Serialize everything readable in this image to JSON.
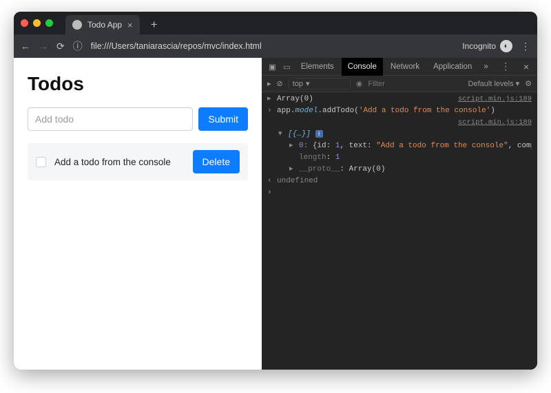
{
  "browser": {
    "tab_title": "Todo App",
    "url": "file:///Users/taniarascia/repos/mvc/index.html",
    "incognito_label": "Incognito"
  },
  "app": {
    "heading": "Todos",
    "input_placeholder": "Add todo",
    "submit_label": "Submit",
    "todo_text": "Add a todo from the console",
    "delete_label": "Delete"
  },
  "devtools": {
    "tabs": {
      "elements": "Elements",
      "console": "Console",
      "network": "Network",
      "application": "Application"
    },
    "toolbar": {
      "context": "top",
      "filter_placeholder": "Filter",
      "levels": "Default levels"
    },
    "console": {
      "line1": "Array(0)",
      "src1": "script.min.js:189",
      "line2_pre": "app.",
      "line2_model": "model",
      "line2_call": ".addTodo(",
      "line2_arg": "'Add a todo from the console'",
      "line2_close": ")",
      "src2": "script.min.js:189",
      "arr_open": "[{…}]",
      "entry_pre": "0: ",
      "entry_obj": "{id: ",
      "entry_id": "1",
      "entry_mid": ", text: ",
      "entry_text": "\"Add a todo from the console\"",
      "entry_tail": ", complete: fal…",
      "length_label": "length",
      "length_val": "1",
      "proto_label": "__proto__",
      "proto_val": "Array(0)",
      "undefined": "undefined"
    }
  }
}
